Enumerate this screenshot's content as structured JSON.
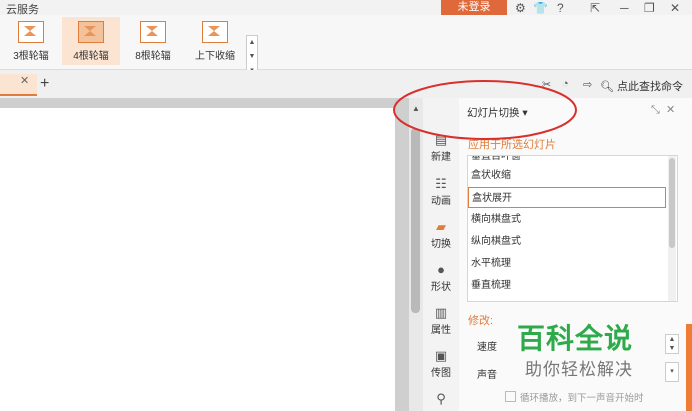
{
  "topbar": {
    "title": "云服务",
    "login": "未登录"
  },
  "ribbon": {
    "effects": [
      "3根轮辐",
      "4根轮辐",
      "8根轮辐",
      "上下收缩"
    ],
    "selected": "4根轮辐"
  },
  "tabrow": {
    "search": "点此查找命令"
  },
  "sidebar": {
    "items": [
      "新建",
      "动画",
      "切换",
      "形状",
      "属性",
      "传图"
    ]
  },
  "pane": {
    "title": "幻灯片切换",
    "dropdown_icon": "caret-down",
    "apply_label": "应用于所选幻灯片",
    "list": [
      "垂直百叶窗",
      "盒状收缩",
      "盒状展开",
      "横向棋盘式",
      "纵向棋盘式",
      "水平梳理",
      "垂直梳理"
    ],
    "selected": "盒状展开",
    "modify_label": "修改:",
    "speed_label": "速度",
    "sound_label": "声音",
    "loop_label": "循环播放，到下一声音开始时"
  },
  "watermark": {
    "title": "百科全说",
    "subtitle": "助你轻松解决"
  },
  "colors": {
    "accent": "#e07d3c",
    "annotation": "#d9302c",
    "watermark": "#2eaa4a"
  }
}
